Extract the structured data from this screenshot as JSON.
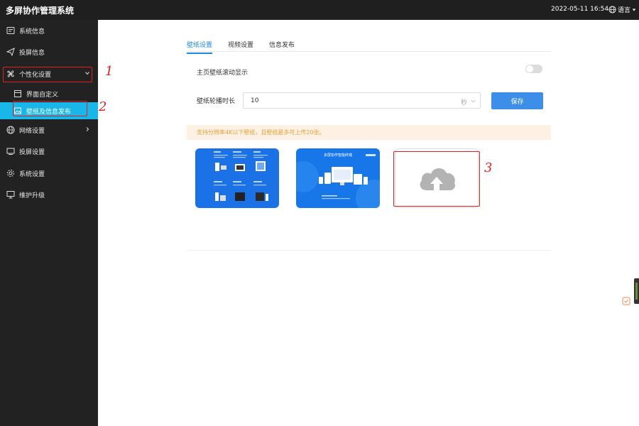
{
  "topbar": {
    "title": "多屏协作管理系统",
    "datetime": "2022-05-11 16:54",
    "language_label": "语言"
  },
  "sidebar": {
    "items": [
      {
        "label": "系统信息",
        "icon": "monitor-info-icon"
      },
      {
        "label": "投屏信息",
        "icon": "send-icon"
      },
      {
        "label": "个性化设置",
        "icon": "fan-icon",
        "expanded": true
      },
      {
        "label": "界面自定义",
        "icon": "layout-icon",
        "sub": true
      },
      {
        "label": "壁纸及信息发布",
        "icon": "image-icon",
        "sub": true,
        "active": true
      },
      {
        "label": "网络设置",
        "icon": "globe-icon"
      },
      {
        "label": "投屏设置",
        "icon": "cast-icon"
      },
      {
        "label": "系统设置",
        "icon": "gear-icon"
      },
      {
        "label": "维护升级",
        "icon": "upgrade-icon"
      }
    ]
  },
  "tabs": [
    {
      "label": "壁纸设置",
      "active": true
    },
    {
      "label": "视频设置"
    },
    {
      "label": "信息发布"
    }
  ],
  "settings": {
    "scroll_label": "主页壁纸滚动显示",
    "scroll_enabled": false,
    "interval_label": "壁纸轮播时长",
    "interval_value": "10",
    "interval_unit": "秒",
    "save_label": "保存"
  },
  "notice": "支持分辨率4K以下壁纸，且壁纸最多可上传20张。",
  "wallpapers": [
    {
      "thumb_title": ""
    },
    {
      "thumb_title": "多屏协作智能终端"
    }
  ],
  "annotations": {
    "num1": "1",
    "num2": "2",
    "num3": "3"
  },
  "colors": {
    "accent": "#1e88e5",
    "sidebar_bg": "#222222",
    "active_bg": "#19b6ea",
    "annotation": "#e02020"
  }
}
